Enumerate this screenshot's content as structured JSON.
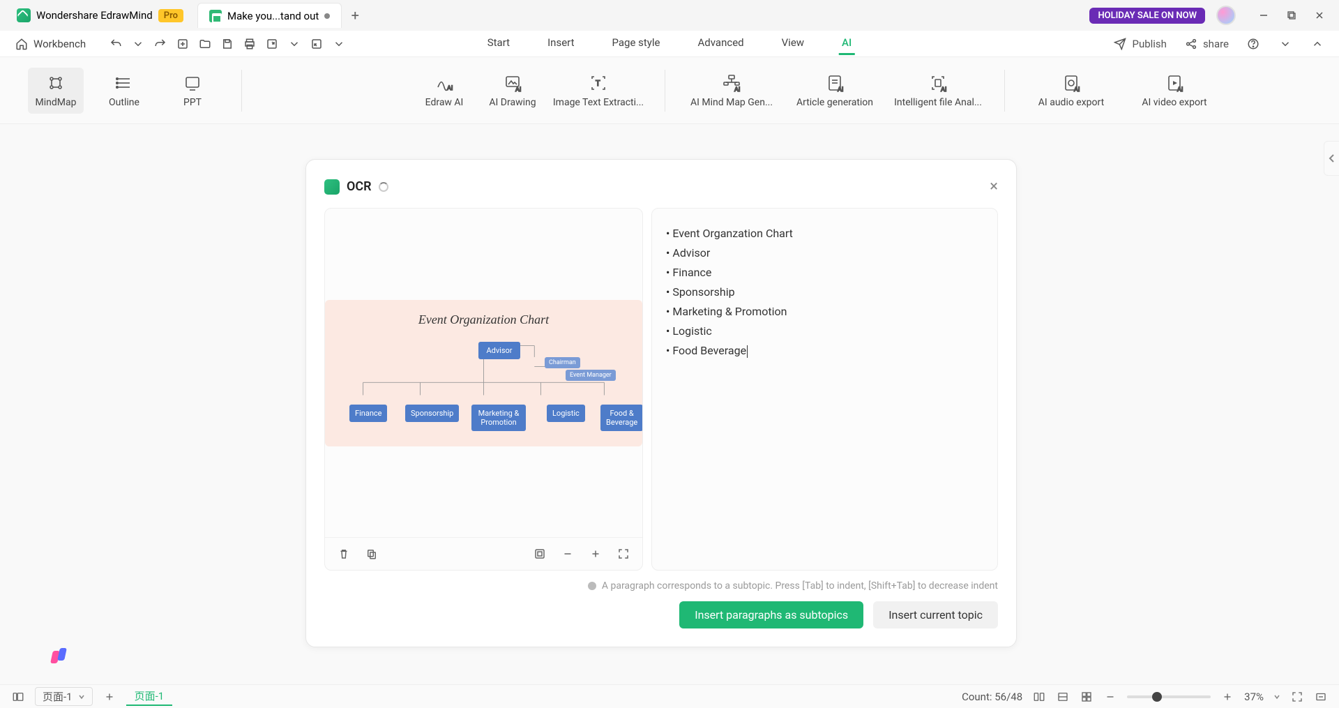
{
  "titlebar": {
    "app_name": "Wondershare EdrawMind",
    "pro_badge": "Pro",
    "doc_tab": "Make you...tand out",
    "holiday": "HOLIDAY SALE ON NOW"
  },
  "toolbar": {
    "workbench": "Workbench",
    "publish": "Publish",
    "share": "share"
  },
  "menu": {
    "start": "Start",
    "insert": "Insert",
    "page_style": "Page style",
    "advanced": "Advanced",
    "view": "View",
    "ai": "AI"
  },
  "ribbon": {
    "mindmap": "MindMap",
    "outline": "Outline",
    "ppt": "PPT",
    "edraw_ai": "Edraw AI",
    "ai_drawing": "AI Drawing",
    "image_text": "Image Text Extracti...",
    "ai_mind_map": "AI Mind Map Gen...",
    "article_gen": "Article generation",
    "intelligent_file": "Intelligent file Anal...",
    "ai_audio": "AI audio export",
    "ai_video": "AI video export"
  },
  "ocr": {
    "title": "OCR",
    "chart_title": "Event Organization Chart",
    "nodes": {
      "advisor": "Advisor",
      "chairman": "Chairman",
      "event_manager": "Event Manager",
      "finance": "Finance",
      "sponsorship": "Sponsorship",
      "marketing": "Marketing & Promotion",
      "logistic": "Logistic",
      "food": "Food & Beverage"
    },
    "results": [
      "Event Organzation Chart",
      "Advisor",
      "Finance",
      "Sponsorship",
      "Marketing & Promotion",
      "Logistic",
      "Food Beverage"
    ],
    "hint": "A paragraph corresponds to a subtopic. Press [Tab] to indent, [Shift+Tab] to decrease indent",
    "btn_primary": "Insert paragraphs as subtopics",
    "btn_secondary": "Insert current topic"
  },
  "status": {
    "page_label": "页面-1",
    "page_tab": "页面-1",
    "count": "Count: 56/48",
    "zoom": "37%"
  }
}
